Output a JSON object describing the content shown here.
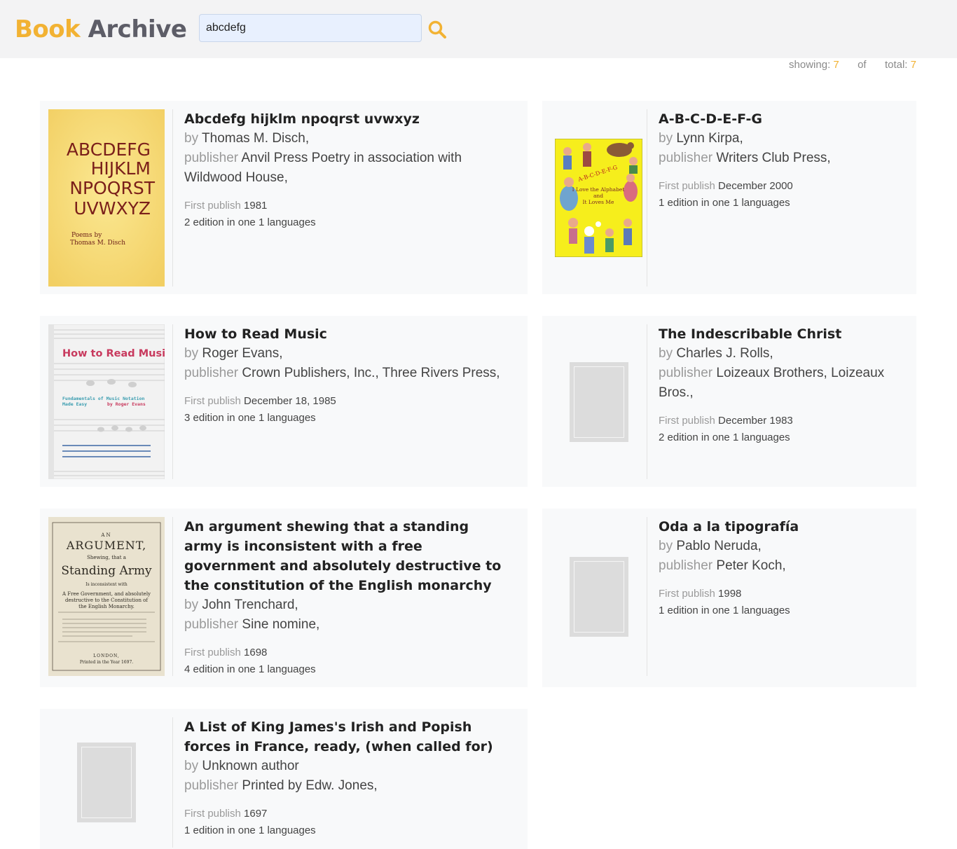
{
  "header": {
    "logo_word1": "Book",
    "logo_word2": "Archive",
    "search_value": "abcdefg",
    "search_icon": "search-icon",
    "accent_color": "#f2b233"
  },
  "counts": {
    "showing_label": "showing:",
    "showing_value": "7",
    "of_label": "of",
    "total_label": "total:",
    "total_value": "7"
  },
  "labels": {
    "by": "by",
    "publisher": "publisher",
    "first_publish": "First publish",
    "edition_in_one": "edition in one",
    "languages": "languages"
  },
  "books": [
    {
      "title": "Abcdefg hijklm npoqrst uvwxyz",
      "author": "Thomas M. Disch,",
      "publisher": "Anvil Press Poetry in association with Wildwood House,",
      "first_publish": "1981",
      "editions": "2",
      "languages": "1",
      "cover": "cover-abcdefg",
      "cover_text": [
        "ABCDEFG",
        "HIJKLM",
        "NPOQRST",
        "UVWXYZ",
        "Poems by",
        "Thomas M. Disch"
      ]
    },
    {
      "title": "A-B-C-D-E-F-G",
      "author": "Lynn Kirpa,",
      "publisher": "Writers Club Press,",
      "first_publish": "December 2000",
      "editions": "1",
      "languages": "1",
      "cover": "cover-alphabet",
      "cover_text": [
        "A-B-C-D-E-F-G",
        "I Love the Alphabet",
        "and",
        "It Loves Me"
      ]
    },
    {
      "title": "How to Read Music",
      "author": "Roger Evans,",
      "publisher": "Crown Publishers, Inc., Three Rivers Press,",
      "first_publish": "December 18, 1985",
      "editions": "3",
      "languages": "1",
      "cover": "cover-music",
      "cover_text": [
        "How to Read Music",
        "Fundamentals of Music Notation",
        "Made Easy",
        "by Roger Evans"
      ]
    },
    {
      "title": "The Indescribable Christ",
      "author": "Charles J. Rolls,",
      "publisher": "Loizeaux Brothers, Loizeaux Bros.,",
      "first_publish": "December 1983",
      "editions": "2",
      "languages": "1",
      "cover": "cover-placeholder"
    },
    {
      "title": "An argument shewing that a standing army is inconsistent with a free government and absolutely destructive to the constitution of the English monarchy",
      "author": "John Trenchard,",
      "publisher": "Sine nomine,",
      "first_publish": "1698",
      "editions": "4",
      "languages": "1",
      "cover": "cover-argument",
      "cover_text": [
        "AN",
        "ARGUMENT,",
        "Shewing, that a",
        "Standing Army",
        "Is inconsistent with",
        "A Free Government, and absolutely",
        "destructive to the Constitution of",
        "the English Monarchy.",
        "LONDON,",
        "Printed in the Year 1697."
      ]
    },
    {
      "title": "Oda a la tipografía",
      "author": "Pablo Neruda,",
      "publisher": "Peter Koch,",
      "first_publish": "1998",
      "editions": "1",
      "languages": "1",
      "cover": "cover-placeholder"
    },
    {
      "title": "A List of King James's Irish and Popish forces in France, ready, (when called for)",
      "author": "Unknown author",
      "publisher": "Printed by Edw. Jones,",
      "first_publish": "1697",
      "editions": "1",
      "languages": "1",
      "cover": "cover-placeholder"
    }
  ]
}
